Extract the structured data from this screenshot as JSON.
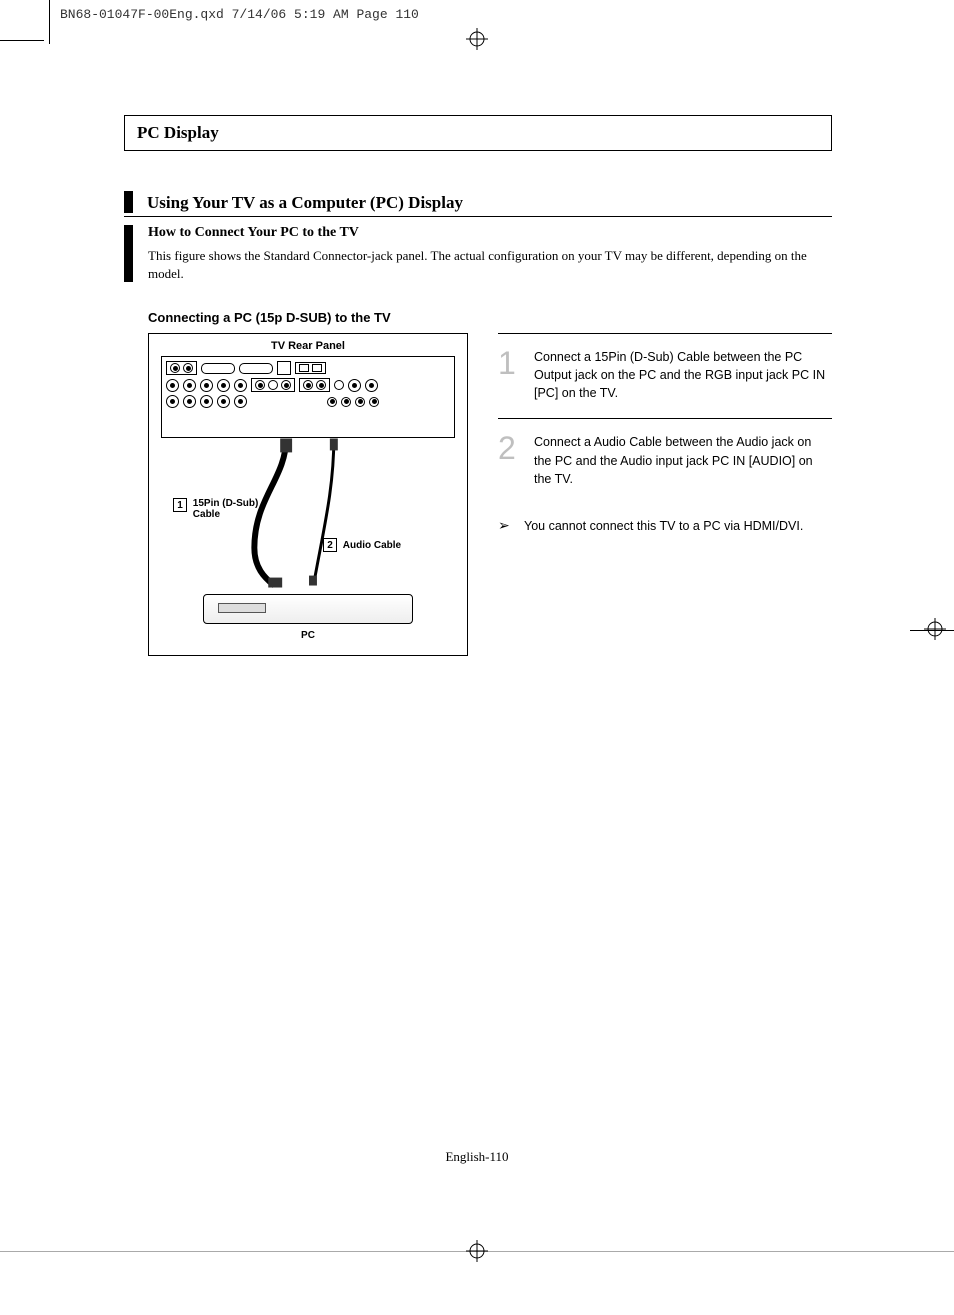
{
  "print_header": "BN68-01047F-00Eng.qxd  7/14/06  5:19 AM  Page 110",
  "section_box": "PC Display",
  "section_title": "Using Your TV as a Computer (PC) Display",
  "intro_bold": "How to Connect Your PC to the TV",
  "intro_desc": "This figure shows the Standard Connector-jack panel. The actual configuration on your TV may be different, depending on the model.",
  "subhead": "Connecting a PC (15p D-SUB) to the TV",
  "diagram": {
    "title": "TV Rear Panel",
    "label1_num": "1",
    "label1_text": "15Pin (D-Sub) Cable",
    "label2_num": "2",
    "label2_text": "Audio Cable",
    "pc_label": "PC"
  },
  "steps": [
    {
      "num": "1",
      "text": "Connect a 15Pin (D-Sub) Cable between the PC Output jack on the PC and the RGB input jack PC IN [PC] on the TV."
    },
    {
      "num": "2",
      "text": "Connect a Audio Cable between the Audio jack on the PC and the Audio input  jack PC IN [AUDIO] on the TV."
    }
  ],
  "note": "You cannot connect this TV to a PC via HDMI/DVI.",
  "footer": "English-110"
}
